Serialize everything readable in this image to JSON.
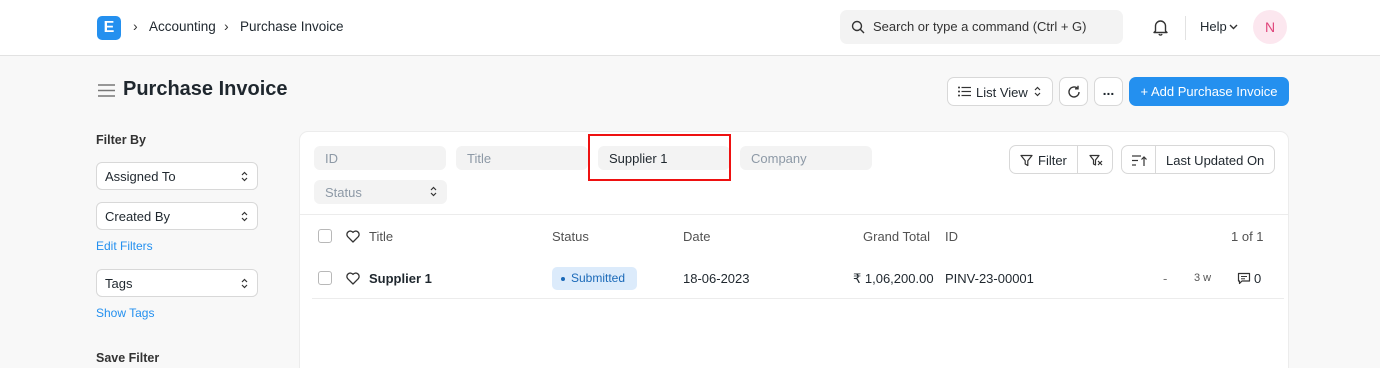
{
  "navbar": {
    "logo_letter": "E",
    "breadcrumbs": [
      "Accounting",
      "Purchase Invoice"
    ],
    "search_placeholder": "Search or type a command (Ctrl + G)",
    "help_label": "Help",
    "avatar_initial": "N"
  },
  "page": {
    "title": "Purchase Invoice",
    "list_view_label": "List View",
    "more_label": "...",
    "add_button_label": "+ Add Purchase Invoice"
  },
  "sidebar": {
    "filter_by_label": "Filter By",
    "assigned_to_label": "Assigned To",
    "created_by_label": "Created By",
    "edit_filters_label": "Edit Filters",
    "tags_label": "Tags",
    "show_tags_label": "Show Tags",
    "save_filter_label": "Save Filter"
  },
  "filters": {
    "id_placeholder": "ID",
    "title_placeholder": "Title",
    "supplier_value": "Supplier 1",
    "company_placeholder": "Company",
    "status_placeholder": "Status",
    "filter_button_label": "Filter",
    "sort_label": "Last Updated On"
  },
  "table": {
    "headers": {
      "title": "Title",
      "status": "Status",
      "date": "Date",
      "grand_total": "Grand Total",
      "id": "ID",
      "count": "1 of 1"
    },
    "rows": [
      {
        "title": "Supplier 1",
        "status": "Submitted",
        "date": "18-06-2023",
        "grand_total": "₹ 1,06,200.00",
        "id": "PINV-23-00001",
        "assigned": "-",
        "modified": "3 w",
        "comments": "0"
      }
    ]
  },
  "colors": {
    "accent": "#2490ef",
    "highlight": "#ee1111",
    "status_badge_bg": "#dcebfb",
    "status_badge_text": "#1a69b8"
  }
}
